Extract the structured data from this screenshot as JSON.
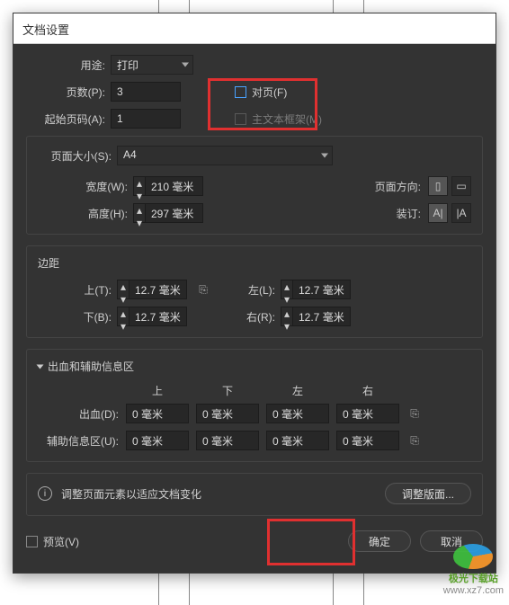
{
  "dialog": {
    "title": "文档设置"
  },
  "intent": {
    "label": "用途:",
    "value": "打印"
  },
  "pages": {
    "label": "页数(P):",
    "value": "3"
  },
  "start": {
    "label": "起始页码(A):",
    "value": "1"
  },
  "facing": {
    "label": "对页(F)"
  },
  "primary_text_frame": {
    "label": "主文本框架(M)"
  },
  "page_size": {
    "title": "页面大小(S):",
    "value": "A4",
    "width_label": "宽度(W):",
    "width_value": "210 毫米",
    "height_label": "高度(H):",
    "height_value": "297 毫米",
    "orientation_label": "页面方向:",
    "binding_label": "装订:"
  },
  "margins": {
    "title": "边距",
    "top_label": "上(T):",
    "top_value": "12.7 毫米",
    "bottom_label": "下(B):",
    "bottom_value": "12.7 毫米",
    "left_label": "左(L):",
    "left_value": "12.7 毫米",
    "right_label": "右(R):",
    "right_value": "12.7 毫米"
  },
  "bleed": {
    "title": "出血和辅助信息区",
    "col_top": "上",
    "col_bottom": "下",
    "col_left": "左",
    "col_right": "右",
    "bleed_label": "出血(D):",
    "bleed_top": "0 毫米",
    "bleed_bottom": "0 毫米",
    "bleed_left": "0 毫米",
    "bleed_right": "0 毫米",
    "slug_label": "辅助信息区(U):",
    "slug_top": "0 毫米",
    "slug_bottom": "0 毫米",
    "slug_left": "0 毫米",
    "slug_right": "0 毫米"
  },
  "layout_adjust": {
    "text": "调整页面元素以适应文档变化",
    "button": "调整版面..."
  },
  "preview": {
    "label": "预览(V)"
  },
  "ok": {
    "label": "确定"
  },
  "cancel": {
    "label": "取消"
  },
  "watermark": {
    "name": "极光下载站",
    "url": "www.xz7.com"
  }
}
